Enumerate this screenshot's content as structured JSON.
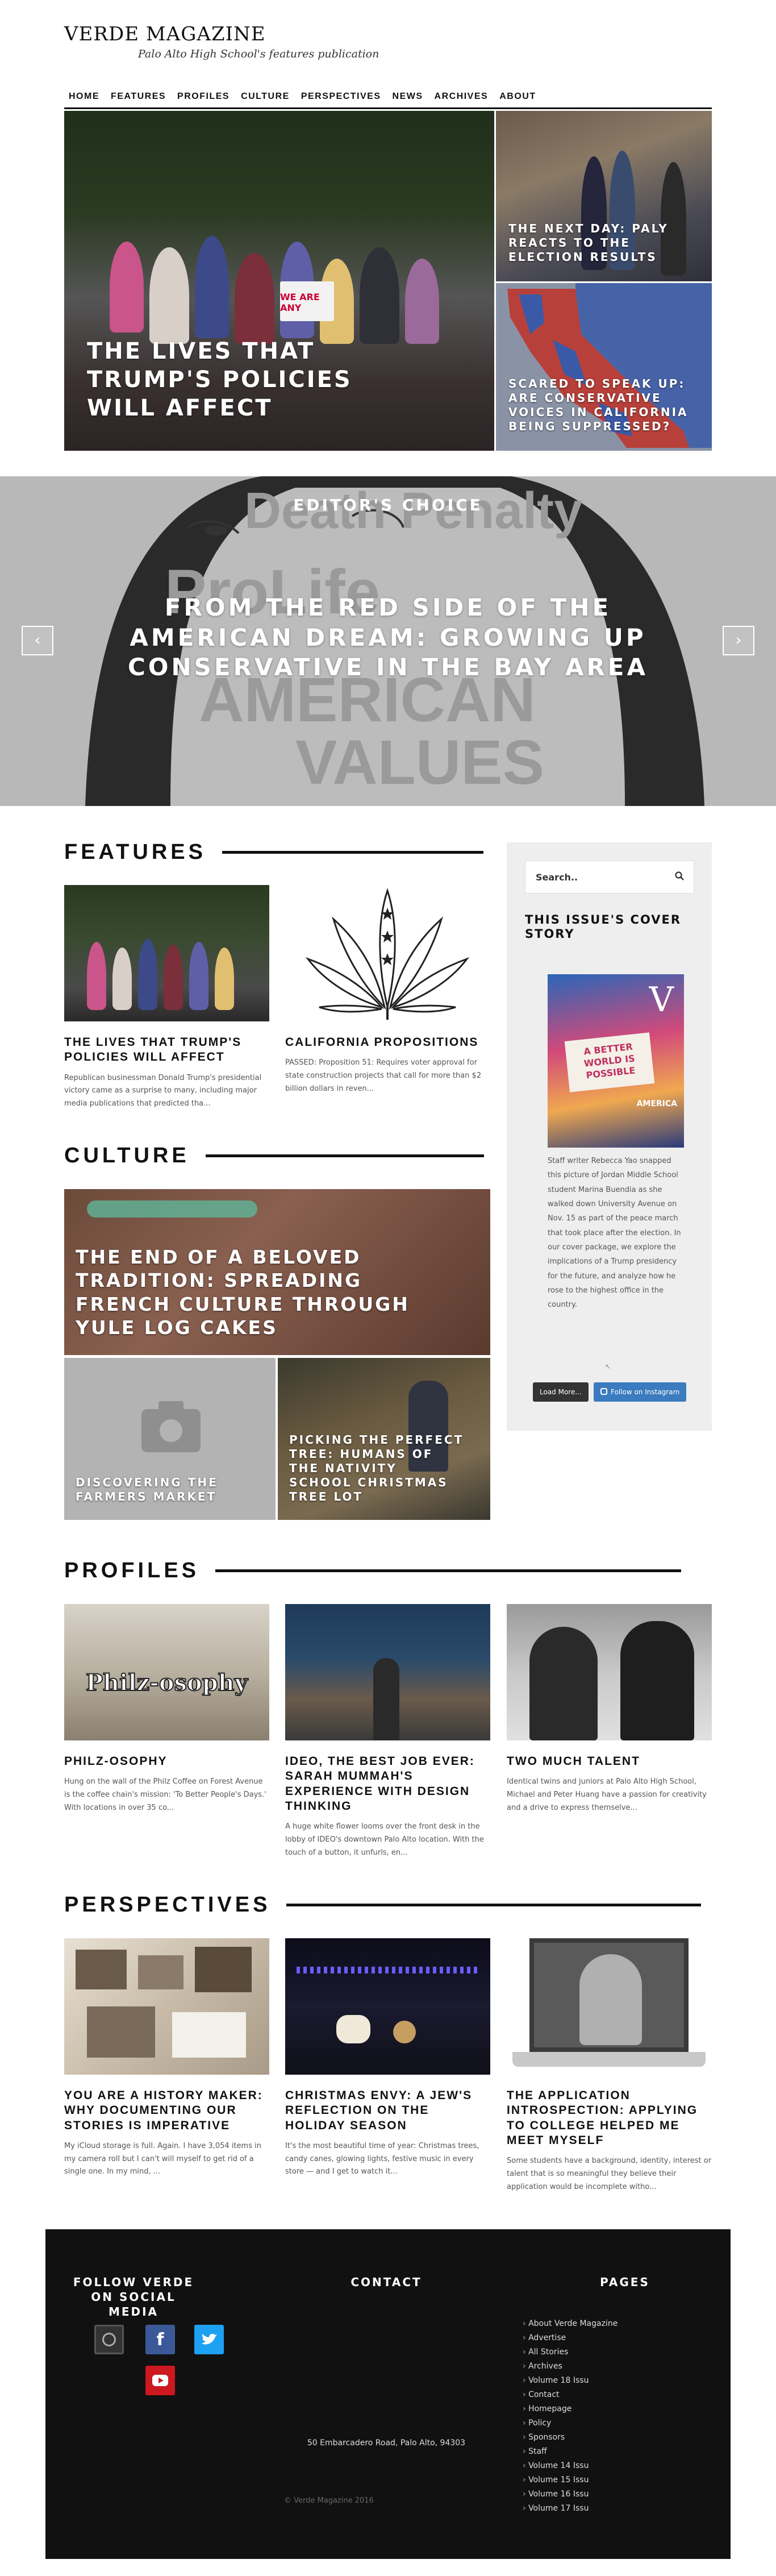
{
  "site": {
    "title": "VERDE MAGAZINE",
    "tagline": "Palo Alto High School's features publication"
  },
  "nav": [
    "HOME",
    "FEATURES",
    "PROFILES",
    "CULTURE",
    "PERSPECTIVES",
    "NEWS",
    "ARCHIVES",
    "ABOUT"
  ],
  "hero": {
    "main_title": "THE LIVES THAT TRUMP'S POLICIES WILL AFFECT",
    "side_top_title": "THE NEXT DAY: PALY REACTS TO THE ELECTION RESULTS",
    "side_bottom_title": "SCARED TO SPEAK UP: ARE CONSERVATIVE VOICES IN CALIFORNIA BEING SUPPRESSED?",
    "sign_text": "WE ARE ANY"
  },
  "slider": {
    "kicker": "EDITOR'S CHOICE",
    "headline": "FROM THE RED SIDE OF THE AMERICAN DREAM: GROWING UP CONSERVATIVE IN THE BAY AREA",
    "ghost_lines": [
      "Death Penalty",
      "ProLife",
      "AMERICAN",
      "VALUES"
    ],
    "prev_icon": "chevron-left-icon",
    "next_icon": "chevron-right-icon"
  },
  "features": {
    "heading": "FEATURES",
    "items": [
      {
        "title": "THE LIVES THAT TRUMP'S POLICIES WILL AFFECT",
        "excerpt": "Republican businessman Donald Trump's presidential victory came as a surprise to many, including major media publications that predicted tha..."
      },
      {
        "title": "CALIFORNIA PROPOSITIONS",
        "excerpt": "PASSED: Proposition 51: Requires voter approval for state construction projects that call for more than $2 billion dollars in reven..."
      }
    ]
  },
  "culture": {
    "heading": "CULTURE",
    "big_title": "THE END OF A BELOVED TRADITION: SPREADING FRENCH CULTURE THROUGH YULE LOG CAKES",
    "small_left_title": "DISCOVERING THE FARMERS MARKET",
    "small_right_title": "PICKING THE PERFECT TREE: HUMANS OF THE NATIVITY SCHOOL CHRISTMAS TREE LOT"
  },
  "sidebar": {
    "search_placeholder": "Search..",
    "cover_heading": "THIS ISSUE'S COVER STORY",
    "cover_caption": "Staff writer Rebecca Yao snapped this picture of Jordan Middle School student Marina Buendia as she walked down University Avenue on Nov. 15 as part of the peace march that took place after the election. In our cover package, we explore the implications of a Trump presidency for the future, and analyze how he rose to the highest office in the country.",
    "cover_overlay_v": "V",
    "cover_sign": "A BETTER WORLD IS POSSIBLE",
    "cover_sub": "AMERICA",
    "load_more": "Load More...",
    "follow_instagram": "Follow on Instagram"
  },
  "profiles": {
    "heading": "PROFILES",
    "items": [
      {
        "title": "PHILZ-OSOPHY",
        "excerpt": "Hung on the wall of the Philz Coffee on Forest Avenue is the coffee chain's mission: 'To Better People's Days.' With locations in over 35 co...",
        "img_text": "Philz-osophy"
      },
      {
        "title": "IDEO, THE BEST JOB EVER: SARAH MUMMAH'S EXPERIENCE WITH DESIGN THINKING",
        "excerpt": "A huge white flower looms over the front desk in the lobby of IDEO's downtown Palo Alto location. With the touch of a button, it unfurls, en..."
      },
      {
        "title": "TWO MUCH TALENT",
        "excerpt": "Identical twins and juniors at Palo Alto High School, Michael and Peter Huang have a passion for creativity and a drive to express themselve..."
      }
    ]
  },
  "perspectives": {
    "heading": "PERSPECTIVES",
    "items": [
      {
        "title": "YOU ARE A HISTORY MAKER: WHY DOCUMENTING OUR STORIES IS IMPERATIVE",
        "excerpt": "My iCloud storage is full. Again. I have 3,054 items in my camera roll but I can't will myself to get rid of a single one. In my mind, ..."
      },
      {
        "title": "CHRISTMAS ENVY: A JEW'S REFLECTION ON THE HOLIDAY SEASON",
        "excerpt": "It's the most beautiful time of year: Christmas trees, candy canes, glowing lights, festive music in every store — and I get to watch it..."
      },
      {
        "title": "THE APPLICATION INTROSPECTION: APPLYING TO COLLEGE HELPED ME MEET MYSELF",
        "excerpt": "Some students have a background, identity, interest or talent that is so meaningful they believe their application would be incomplete witho..."
      }
    ]
  },
  "footer": {
    "social_heading": "FOLLOW VERDE ON SOCIAL MEDIA",
    "contact_heading": "CONTACT",
    "pages_heading": "PAGES",
    "address": "50 Embarcadero Road, Palo Alto, 94303",
    "copyright": "© Verde Magazine 2016",
    "pages": [
      "About Verde Magazine",
      "Advertise",
      "All Stories",
      "Archives",
      "Volume 18 Issu",
      "Contact",
      "Homepage",
      "Policy",
      "Sponsors",
      "Staff",
      "Volume 14 Issu",
      "Volume 15 Issu",
      "Volume 16 Issu",
      "Volume 17 Issu"
    ],
    "social_icons": [
      "instagram-icon",
      "facebook-icon",
      "twitter-icon",
      "youtube-icon"
    ]
  },
  "colors": {
    "accent_black": "#111111",
    "footer_bg": "#111111",
    "facebook": "#3b5998",
    "twitter": "#1da1f2",
    "youtube": "#cc181e",
    "instagram_button": "#3b7bbf"
  }
}
